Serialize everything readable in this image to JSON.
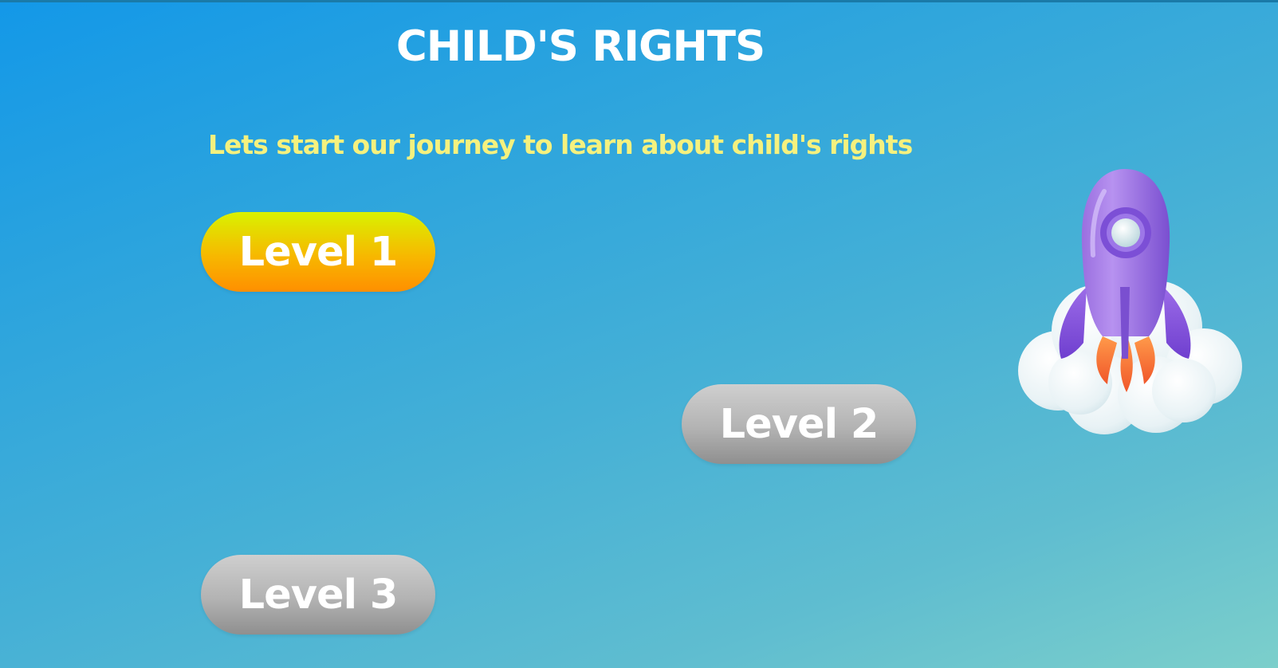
{
  "page": {
    "title": "CHILD'S RIGHTS",
    "subtitle": "Lets start our journey to learn about child's rights"
  },
  "levels": [
    {
      "label": "Level 1",
      "state": "active",
      "colors": [
        "#d9f200",
        "#ff8f00"
      ]
    },
    {
      "label": "Level 2",
      "state": "locked",
      "colors": [
        "#cfcfcf",
        "#8f8f8f"
      ]
    },
    {
      "label": "Level 3",
      "state": "locked",
      "colors": [
        "#cfcfcf",
        "#8f8f8f"
      ]
    }
  ],
  "illustration": {
    "icon": "rocket-on-cloud-icon"
  },
  "colors": {
    "title": "#ffffff",
    "subtitle": "#f5f17e",
    "background_start": "#1398e8",
    "background_end": "#7ccfcb"
  }
}
